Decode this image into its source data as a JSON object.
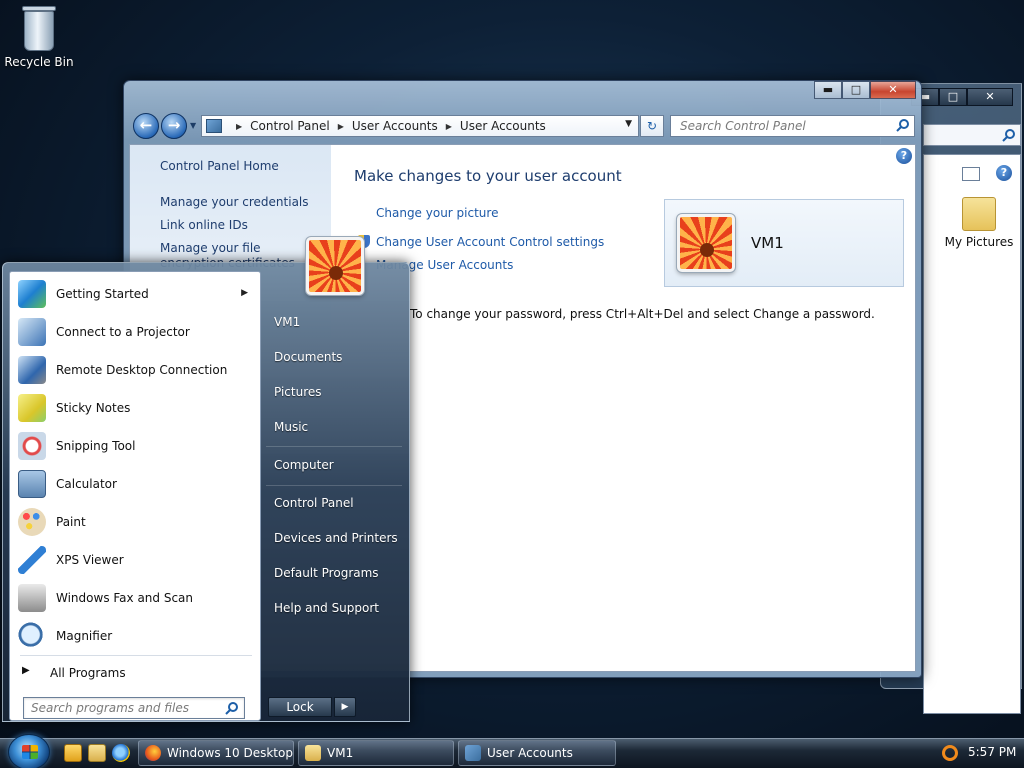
{
  "desktop": {
    "recycle_bin_label": "Recycle Bin"
  },
  "back_window": {
    "folder_label": "My Pictures",
    "minimize": "▬",
    "maximize": "□",
    "close": "✕"
  },
  "control_panel_window": {
    "breadcrumb": [
      "Control Panel",
      "User Accounts",
      "User Accounts"
    ],
    "search_placeholder": "Search Control Panel",
    "minimize": "▬",
    "maximize": "□",
    "close": "✕",
    "sidebar": {
      "home": "Control Panel Home",
      "links": [
        "Manage your credentials",
        "Link online IDs",
        "Manage your file encryption certificates"
      ]
    },
    "heading": "Make changes to your user account",
    "tasks": [
      "Change your picture",
      "Change User Account Control settings",
      "Manage User Accounts"
    ],
    "password_note": "To change your password, press Ctrl+Alt+Del and select Change a password.",
    "user_name": "VM1"
  },
  "start_menu": {
    "programs": [
      {
        "label": "Getting Started",
        "icon": "getting-started-icon",
        "has_submenu": true
      },
      {
        "label": "Connect to a Projector",
        "icon": "projector-icon",
        "has_submenu": false
      },
      {
        "label": "Remote Desktop Connection",
        "icon": "remote-desktop-icon",
        "has_submenu": false
      },
      {
        "label": "Sticky Notes",
        "icon": "sticky-notes-icon",
        "has_submenu": false
      },
      {
        "label": "Snipping Tool",
        "icon": "snipping-tool-icon",
        "has_submenu": false
      },
      {
        "label": "Calculator",
        "icon": "calculator-icon",
        "has_submenu": false
      },
      {
        "label": "Paint",
        "icon": "paint-icon",
        "has_submenu": false
      },
      {
        "label": "XPS Viewer",
        "icon": "xps-viewer-icon",
        "has_submenu": false
      },
      {
        "label": "Windows Fax and Scan",
        "icon": "fax-scan-icon",
        "has_submenu": false
      },
      {
        "label": "Magnifier",
        "icon": "magnifier-icon",
        "has_submenu": false
      }
    ],
    "all_programs": "All Programs",
    "search_placeholder": "Search programs and files",
    "right_items": {
      "user": "VM1",
      "documents": "Documents",
      "pictures": "Pictures",
      "music": "Music",
      "computer": "Computer",
      "control_panel": "Control Panel",
      "devices": "Devices and Printers",
      "default_programs": "Default Programs",
      "help": "Help and Support"
    },
    "lock_label": "Lock",
    "lock_arrow": "▶"
  },
  "taskbar": {
    "buttons": [
      "Windows 10 Desktop...",
      "VM1",
      "User Accounts"
    ],
    "clock": "5:57 PM"
  },
  "colors": {
    "link_blue": "#1e5aa8",
    "heading_blue": "#1e3d6e",
    "accent_orange": "#e8401c"
  }
}
